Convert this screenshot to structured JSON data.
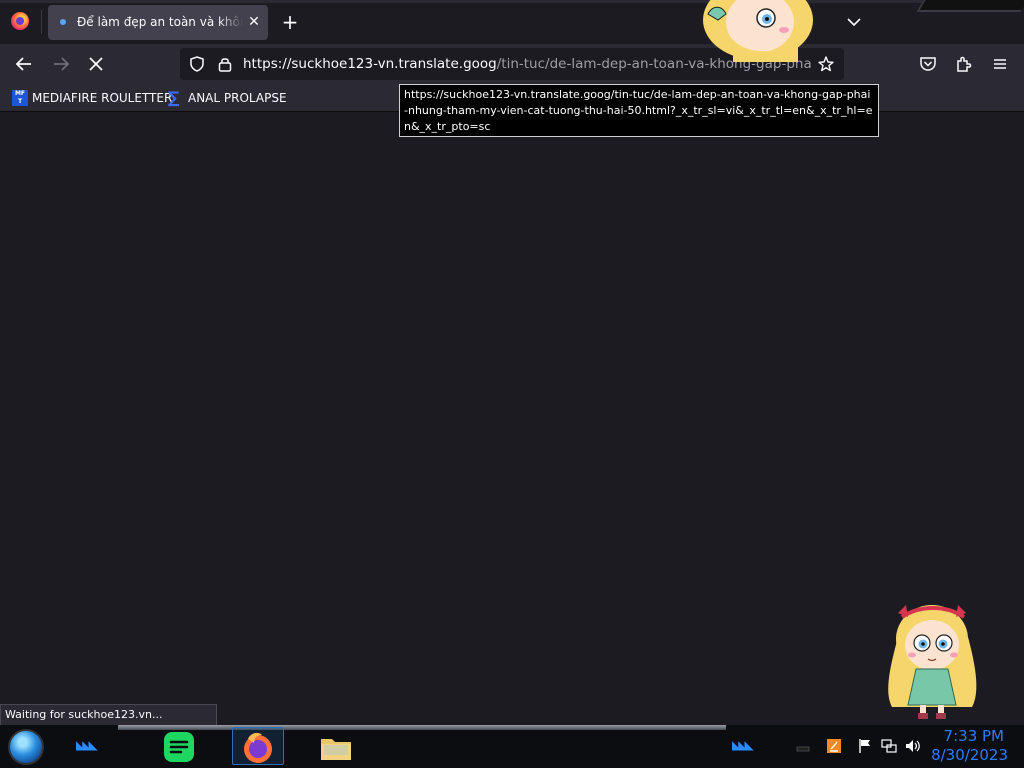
{
  "tabs": [
    {
      "title": "Để làm đẹp an toàn và không gặp phải những thẩm mỹ viện cắt tường thứ hai",
      "close_glyph": "✕"
    }
  ],
  "new_tab_glyph": "+",
  "address_bar": {
    "url_host": "https://suckhoe123-vn.translate.goog",
    "url_path": "/tin-tuc/de-lam-dep-an-toan-va-khong-gap-phai-nhung-tham-my-vien-cat-tuong-thu-hai-50.html"
  },
  "bookmarks": [
    {
      "label": "MEDIAFIRE ROULETTER",
      "icon_text": "MF\nT"
    },
    {
      "label": "ANAL PROLAPSE",
      "icon_text": "∑"
    }
  ],
  "tooltip": {
    "text": "https://suckhoe123-vn.translate.goog/tin-tuc/de-lam-dep-an-toan-va-khong-gap-phai-nhung-tham-my-vien-cat-tuong-thu-hai-50.html?_x_tr_sl=vi&_x_tr_tl=en&_x_tr_hl=en&_x_tr_pto=sc"
  },
  "status_bar": {
    "text": "Waiting for suckhoe123.vn..."
  },
  "taskbar": {
    "clock_time": "7:33 PM",
    "clock_date": "8/30/2023",
    "chevrons": "◣◣◣"
  },
  "colors": {
    "accent": "#2a7cff",
    "toolbar": "#2b2a33",
    "content_bg": "#1c1b22"
  }
}
